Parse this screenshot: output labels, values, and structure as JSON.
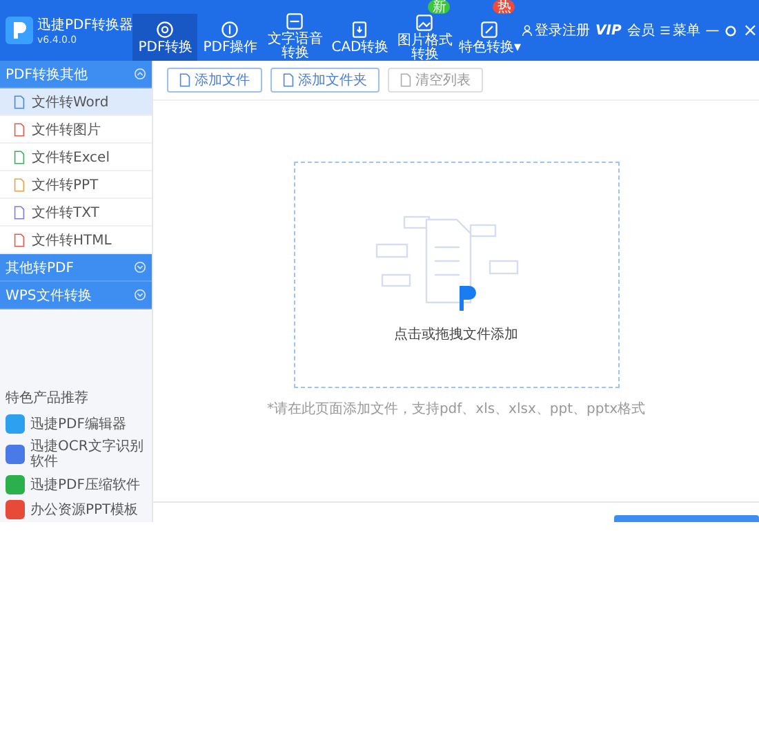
{
  "app": {
    "title": "迅捷PDF转换器",
    "version": "v6.4.0.0"
  },
  "nav": [
    {
      "label": "PDF转换",
      "selected": true,
      "kind": "circle"
    },
    {
      "label": "PDF操作",
      "selected": false,
      "kind": "ring"
    },
    {
      "label": "文字语音转换",
      "selected": false,
      "kind": "frame"
    },
    {
      "label": "CAD转换",
      "selected": false,
      "kind": "doc"
    },
    {
      "label": "图片格式转换",
      "selected": false,
      "kind": "image",
      "badge": "新",
      "color": "#3cc43c"
    },
    {
      "label": "特色转换▾",
      "selected": false,
      "kind": "edit",
      "badge": "热",
      "color": "#f04a3a"
    }
  ],
  "header_right": {
    "login": "登录注册",
    "vip": "VIP",
    "vip_label": "会员",
    "menu": "菜单",
    "minimize": "—",
    "close": "×"
  },
  "sidebar": {
    "groups": [
      {
        "label": "PDF转换其他",
        "expanded": true,
        "items": [
          {
            "label": "文件转Word",
            "selected": true,
            "color": "#4a86e8"
          },
          {
            "label": "文件转图片",
            "selected": false,
            "color": "#e8584a"
          },
          {
            "label": "文件转Excel",
            "selected": false,
            "color": "#3cae5c"
          },
          {
            "label": "文件转PPT",
            "selected": false,
            "color": "#e8a04a"
          },
          {
            "label": "文件转TXT",
            "selected": false,
            "color": "#7a7ae8"
          },
          {
            "label": "文件转HTML",
            "selected": false,
            "color": "#e8584a"
          }
        ]
      },
      {
        "label": "其他转PDF",
        "expanded": false
      },
      {
        "label": "WPS文件转换",
        "expanded": false
      }
    ],
    "products_title": "特色产品推荐",
    "products": [
      {
        "label": "迅捷PDF编辑器",
        "color": "#2ea0f0"
      },
      {
        "label": "迅捷OCR文字识别软件",
        "color": "#4a7ae8"
      },
      {
        "label": "迅捷PDF压缩软件",
        "color": "#2cb04c"
      },
      {
        "label": "办公资源PPT模板",
        "color": "#e84a3a"
      }
    ]
  },
  "toolbar": [
    {
      "label": "添加文件",
      "disabled": false
    },
    {
      "label": "添加文件夹",
      "disabled": false
    },
    {
      "label": "清空列表",
      "disabled": true
    }
  ],
  "dropzone": {
    "label": "点击或拖拽文件添加",
    "note": "*请在此页面添加文件，支持pdf、xls、xlsx、ppt、pptx格式"
  }
}
